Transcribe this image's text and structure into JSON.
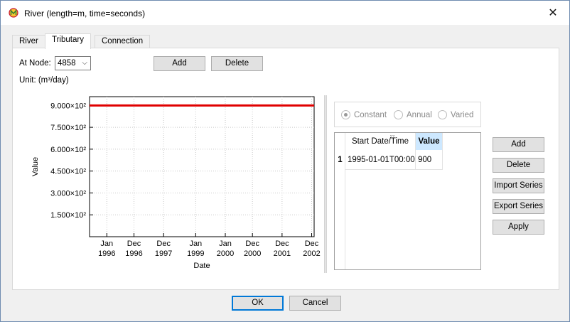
{
  "window": {
    "title": "River (length=m, time=seconds)",
    "close_glyph": "✕"
  },
  "tabs": [
    {
      "label": "River",
      "active": false
    },
    {
      "label": "Tributary",
      "active": true
    },
    {
      "label": "Connection",
      "active": false
    }
  ],
  "node": {
    "label": "At Node:",
    "selected": "4858",
    "unit_label": "Unit: (m³/day)"
  },
  "top_buttons": {
    "add": "Add",
    "delete": "Delete"
  },
  "chart_data": {
    "type": "line",
    "xlabel": "Date",
    "ylabel": "Value",
    "ylim": [
      0,
      960
    ],
    "yticks": [
      150,
      300,
      450,
      600,
      750,
      900
    ],
    "ytick_labels": [
      "1.500×10²",
      "3.000×10²",
      "4.500×10²",
      "6.000×10²",
      "7.500×10²",
      "9.000×10²"
    ],
    "xlim": [
      "1995-06",
      "2003-01"
    ],
    "xticks": [
      "1996-01",
      "1996-12",
      "1997-12",
      "1999-01",
      "2000-01",
      "2000-12",
      "2001-12",
      "2002-12"
    ],
    "xtick_labels": [
      [
        "Jan",
        "1996"
      ],
      [
        "Dec",
        "1996"
      ],
      [
        "Dec",
        "1997"
      ],
      [
        "Jan",
        "1999"
      ],
      [
        "Jan",
        "2000"
      ],
      [
        "Dec",
        "2000"
      ],
      [
        "Dec",
        "2001"
      ],
      [
        "Dec",
        "2002"
      ]
    ],
    "grid": true,
    "series": [
      {
        "color": "#e00000",
        "x": [
          "1995-06",
          "2003-01"
        ],
        "y": [
          900,
          900
        ]
      }
    ]
  },
  "mode": {
    "options": [
      "Constant",
      "Annual",
      "Varied"
    ],
    "selected": "Constant"
  },
  "table": {
    "columns": [
      "Start Date/Time",
      "Value"
    ],
    "rows": [
      {
        "index": "1",
        "start": "1995-01-01T00:00",
        "value": "900"
      }
    ]
  },
  "side_buttons": {
    "add": "Add",
    "delete": "Delete",
    "import": "Import Series",
    "export": "Export Series",
    "apply": "Apply"
  },
  "footer": {
    "ok": "OK",
    "cancel": "Cancel"
  }
}
